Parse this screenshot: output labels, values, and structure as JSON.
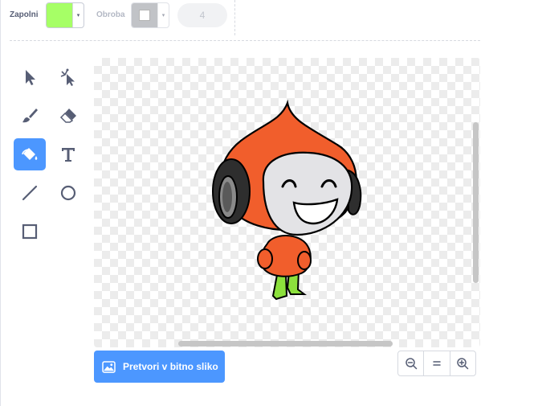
{
  "toolbar": {
    "fill_label": "Zapolni",
    "fill_color": "#a6ff66",
    "outline_label": "Obroba",
    "outline_width": "4"
  },
  "tools": [
    {
      "name": "select",
      "icon": "select-arrow-icon",
      "active": false
    },
    {
      "name": "reshape",
      "icon": "reshape-icon",
      "active": false
    },
    {
      "name": "brush",
      "icon": "brush-icon",
      "active": false
    },
    {
      "name": "eraser",
      "icon": "eraser-icon",
      "active": false
    },
    {
      "name": "fill",
      "icon": "fill-bucket-icon",
      "active": true
    },
    {
      "name": "text",
      "icon": "text-icon",
      "active": false
    },
    {
      "name": "line",
      "icon": "line-icon",
      "active": false
    },
    {
      "name": "circle",
      "icon": "circle-icon",
      "active": false
    },
    {
      "name": "rectangle",
      "icon": "rectangle-icon",
      "active": false
    }
  ],
  "colors": {
    "accent": "#4c97ff",
    "sprite_orange": "#f15e2c",
    "sprite_leg_green": "#8ce03c"
  },
  "actions": {
    "convert_bitmap_label": "Pretvori v bitno sliko"
  },
  "zoom": {
    "zoom_out_icon": "zoom-out-icon",
    "reset_icon": "zoom-reset-icon",
    "zoom_in_icon": "zoom-in-icon"
  }
}
